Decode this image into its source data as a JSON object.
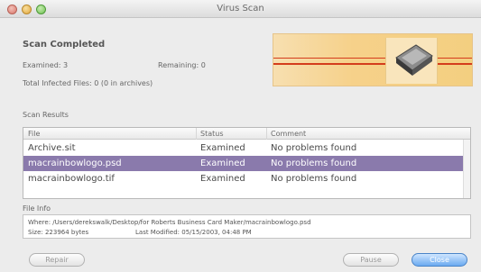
{
  "window": {
    "title": "Virus Scan"
  },
  "summary": {
    "heading": "Scan Completed",
    "examined": "Examined: 3",
    "remaining": "Remaining: 0",
    "infected": "Total Infected Files: 0 (0 in archives)"
  },
  "results": {
    "section_label": "Scan Results",
    "columns": [
      "File",
      "Status",
      "Comment"
    ],
    "rows": [
      {
        "file": "Archive.sit",
        "status": "Examined",
        "comment": "No problems found"
      },
      {
        "file": "macrainbowlogo.psd",
        "status": "Examined",
        "comment": "No problems found"
      },
      {
        "file": "macrainbowlogo.tif",
        "status": "Examined",
        "comment": "No problems found"
      }
    ],
    "selected_row": 1
  },
  "file_info": {
    "section_label": "File Info",
    "where": "Where: /Users/derekswalk/Desktop/for Roberts Business Card Maker/macrainbowlogo.psd",
    "size": "Size: 223964 bytes",
    "last_modified": "Last Modified: 05/15/2003, 04:48 PM"
  },
  "buttons": {
    "repair": "Repair",
    "pause": "Pause",
    "close": "Close"
  },
  "colors": {
    "selection": "#8a7aac",
    "default_button": "#6aaaf0",
    "banner_stripe": "#d43c1c"
  },
  "icons": {
    "banner_graphic": "hard-drive-icon"
  }
}
